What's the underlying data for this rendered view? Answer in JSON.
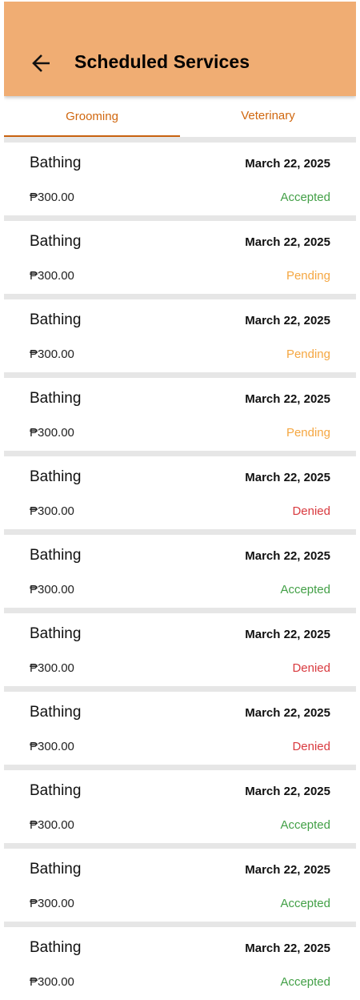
{
  "header": {
    "title": "Scheduled Services",
    "back_icon": "arrow-left-icon",
    "background_color": "#f0ad73"
  },
  "tabs": [
    {
      "label": "Grooming",
      "active": true
    },
    {
      "label": "Veterinary",
      "active": false
    }
  ],
  "accent_color": "#d0670f",
  "status_colors": {
    "Accepted": "#43a047",
    "Pending": "#f5a742",
    "Denied": "#d93a3f"
  },
  "services": [
    {
      "name": "Bathing",
      "date": "March 22, 2025",
      "price": "₱300.00",
      "status": "Accepted"
    },
    {
      "name": "Bathing",
      "date": "March 22, 2025",
      "price": "₱300.00",
      "status": "Pending"
    },
    {
      "name": "Bathing",
      "date": "March 22, 2025",
      "price": "₱300.00",
      "status": "Pending"
    },
    {
      "name": "Bathing",
      "date": "March 22, 2025",
      "price": "₱300.00",
      "status": "Pending"
    },
    {
      "name": "Bathing",
      "date": "March 22, 2025",
      "price": "₱300.00",
      "status": "Denied"
    },
    {
      "name": "Bathing",
      "date": "March 22, 2025",
      "price": "₱300.00",
      "status": "Accepted"
    },
    {
      "name": "Bathing",
      "date": "March 22, 2025",
      "price": "₱300.00",
      "status": "Denied"
    },
    {
      "name": "Bathing",
      "date": "March 22, 2025",
      "price": "₱300.00",
      "status": "Denied"
    },
    {
      "name": "Bathing",
      "date": "March 22, 2025",
      "price": "₱300.00",
      "status": "Accepted"
    },
    {
      "name": "Bathing",
      "date": "March 22, 2025",
      "price": "₱300.00",
      "status": "Accepted"
    },
    {
      "name": "Bathing",
      "date": "March 22, 2025",
      "price": "₱300.00",
      "status": "Accepted"
    }
  ]
}
